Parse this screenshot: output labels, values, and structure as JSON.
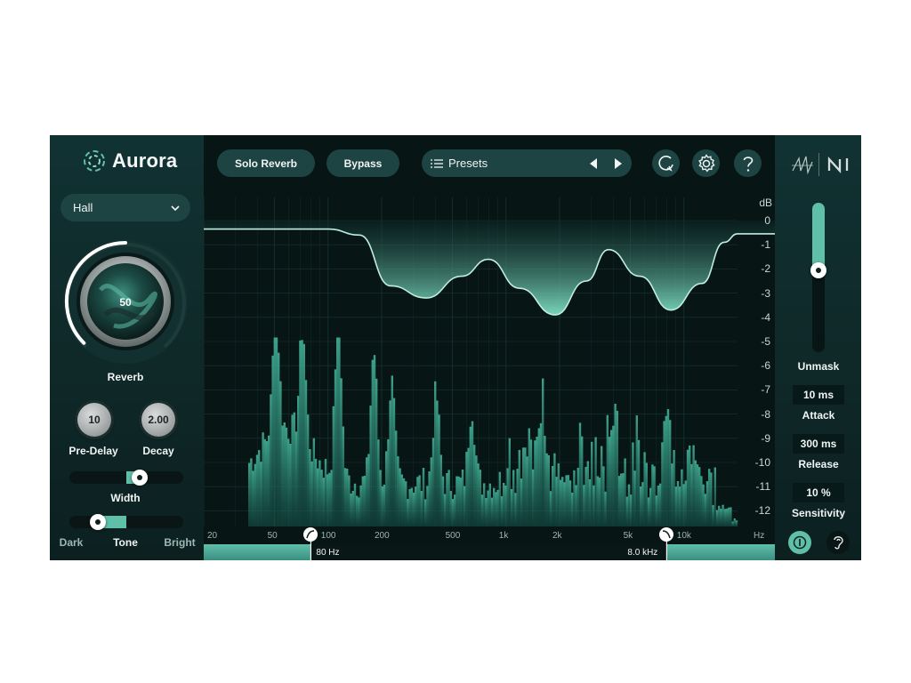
{
  "app": {
    "title": "Aurora"
  },
  "left": {
    "room_dropdown": {
      "value": "Hall"
    },
    "reverb_knob": {
      "value": "50",
      "label": "Reverb",
      "level": 0.5
    },
    "predelay_knob": {
      "value": "10",
      "label": "Pre-Delay"
    },
    "decay_knob": {
      "value": "2.00",
      "label": "Decay"
    },
    "width_slider": {
      "label": "Width",
      "level": 0.62
    },
    "tone_slider": {
      "label": "Tone",
      "left_label": "Dark",
      "right_label": "Bright",
      "level": 0.25
    }
  },
  "toolbar": {
    "solo_reverb_label": "Solo Reverb",
    "bypass_label": "Bypass",
    "presets_label": "Presets",
    "icons": [
      "list-icon",
      "prev-arrow-icon",
      "next-arrow-icon",
      "refresh-icon",
      "gear-icon",
      "help-icon"
    ]
  },
  "display": {
    "db_unit": "dB",
    "db_ticks": [
      "0",
      "-1",
      "-2",
      "-3",
      "-4",
      "-5",
      "-6",
      "-7",
      "-8",
      "-9",
      "-10",
      "-11",
      "-12"
    ],
    "freq_ticks": [
      "20",
      "50",
      "100",
      "200",
      "500",
      "1k",
      "2k",
      "5k",
      "10k"
    ],
    "freq_unit": "Hz",
    "low_cut": {
      "value": "80 Hz",
      "hz": 80
    },
    "high_cut": {
      "value": "8.0 kHz",
      "hz": 8000
    },
    "accent": "#5fbfa9"
  },
  "right": {
    "brand_icons": [
      "izotope-logo-icon",
      "ni-logo-icon"
    ],
    "unmask_slider": {
      "label": "Unmask",
      "level": 0.55
    },
    "attack": {
      "value": "10 ms",
      "label": "Attack"
    },
    "release": {
      "value": "300 ms",
      "label": "Release"
    },
    "sensitivity": {
      "value": "10 %",
      "label": "Sensitivity"
    },
    "buttons": [
      "power-icon",
      "ear-icon"
    ]
  }
}
